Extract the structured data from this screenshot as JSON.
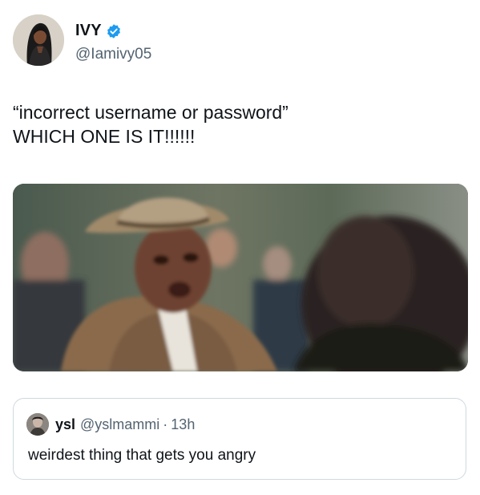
{
  "author": {
    "display_name": "IVY",
    "handle": "@Iamivy05",
    "avatar_icon": "profile-photo",
    "verified_icon": "verified-badge-icon",
    "verified_color": "#1d9bf0"
  },
  "tweet": {
    "lines": [
      "“incorrect username or password”",
      "WHICH ONE IS IT!!!!!!"
    ]
  },
  "media": {
    "kind": "image",
    "description_icon": "angry-man-in-hat-photo"
  },
  "quote": {
    "display_name": "ysl",
    "handle": "@yslmammi",
    "separator": "·",
    "time": "13h",
    "text": "weirdest thing that gets you angry",
    "avatar_icon": "profile-photo"
  },
  "colors": {
    "text_primary": "#0f1419",
    "text_secondary": "#536471",
    "border": "#cfd9de",
    "background": "#ffffff"
  }
}
